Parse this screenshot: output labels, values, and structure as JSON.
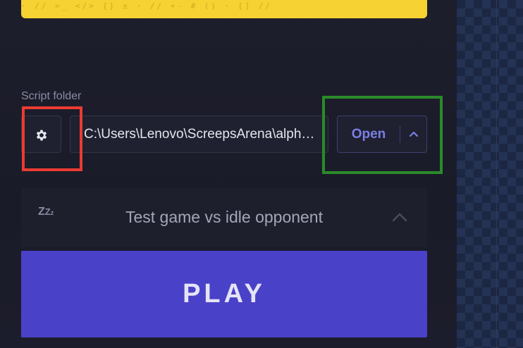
{
  "banner": {
    "doodles": "·  //  >_  </>  {}  ±  ·  //  +-  #  ()  ·  []  //"
  },
  "script_folder": {
    "label": "Script folder",
    "path_value": "C:\\Users\\Lenovo\\ScreepsArena\\alpha-capture_the_flag",
    "open_label": "Open",
    "settings_icon": "gear-icon",
    "expand_icon": "chevron-up-icon"
  },
  "mode": {
    "icon": "sleep-zzz-icon",
    "icon_text": [
      "Z",
      "Z",
      "z"
    ],
    "label": "Test game vs idle opponent",
    "chevron_icon": "chevron-up-icon"
  },
  "play": {
    "label": "PLAY"
  },
  "colors": {
    "accent": "#4a41c9",
    "open_text": "#7b7fe3",
    "banner": "#f6d232",
    "highlight_red": "#ea3b33",
    "highlight_green": "#2a8a2a"
  }
}
